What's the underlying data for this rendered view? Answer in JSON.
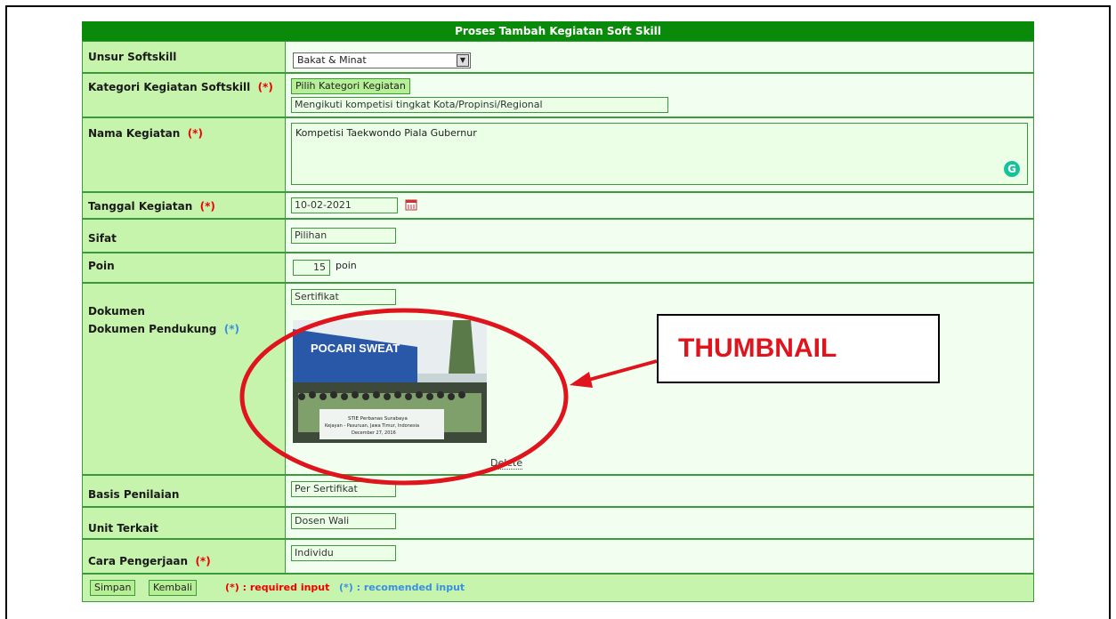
{
  "form": {
    "title": "Proses Tambah Kegiatan Soft Skill",
    "rows": {
      "unsur": {
        "label": "Unsur Softskill",
        "value": "Bakat & Minat"
      },
      "kategori": {
        "label": "Kategori Kegiatan Softskill",
        "mark": "(*)",
        "button": "Pilih Kategori Kegiatan",
        "value": "Mengikuti kompetisi tingkat Kota/Propinsi/Regional"
      },
      "nama": {
        "label": "Nama Kegiatan",
        "mark": "(*)",
        "value": "Kompetisi Taekwondo Piala Gubernur"
      },
      "tanggal": {
        "label": "Tanggal Kegiatan",
        "mark": "(*)",
        "value": "10-02-2021"
      },
      "sifat": {
        "label": "Sifat",
        "value": "Pilihan"
      },
      "poin": {
        "label": "Poin",
        "value": "15",
        "unit": "poin"
      },
      "dokumen": {
        "label": "Dokumen",
        "value": "Sertifikat"
      },
      "pendukung": {
        "label": "Dokumen Pendukung",
        "mark": "(*)",
        "delete": "Delete",
        "photo_text": {
          "banner": "POCARI SWEAT",
          "l1": "STIE Perbanas Surabaya",
          "l2": "Kejayan - Pasuruan, Jawa Timur, Indonesia",
          "l3": "December 27, 2016"
        }
      },
      "basis": {
        "label": "Basis Penilaian",
        "value": "Per Sertifikat"
      },
      "unit": {
        "label": "Unit Terkait",
        "value": "Dosen Wali"
      },
      "cara": {
        "label": "Cara Pengerjaan",
        "mark": "(*)",
        "value": "Individu"
      }
    },
    "footer": {
      "save": "Simpan",
      "back": "Kembali",
      "required_note": "(*) : required input",
      "recommended_note": "(*) : recomended input"
    }
  },
  "annotation": {
    "callout": "THUMBNAIL",
    "colors": {
      "red": "#e0141c"
    }
  },
  "colors": {
    "header": "#0a8a0a",
    "label_bg": "#c6f4ad",
    "required": "#e00000",
    "recommended": "#3a8fe0"
  }
}
